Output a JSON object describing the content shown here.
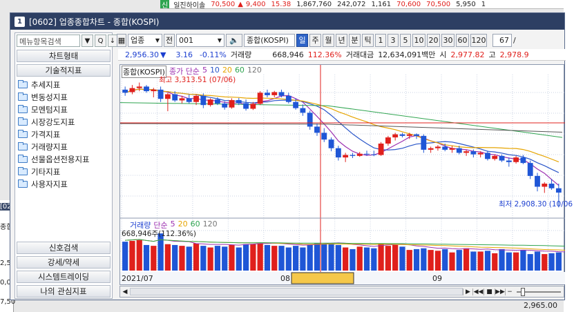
{
  "ticker": {
    "badge": "신",
    "name": "일진하이솔",
    "price": "70,500",
    "change_arrow": "▲",
    "change": "9,400",
    "rate": "15.38",
    "volume": "1,867,760",
    "v2": "242,072",
    "v3": "1,161",
    "v4": "70,600",
    "v5": "70,500",
    "v6": "5,950",
    "v7": "1"
  },
  "bg_left": {
    "labels": [
      "[02",
      "종합",
      "2,50",
      "0,00",
      "7,50"
    ]
  },
  "bg_right": {
    "value": "2,965.00"
  },
  "window": {
    "number": "1",
    "title": "[0602] 업종종합차트 - 종합(KOSPI)"
  },
  "left_panel": {
    "search_placeholder": "메뉴항목검색",
    "btn_dropdown": "▼",
    "btn_search": "Q",
    "btn_down": "↓",
    "section_chart_type": "차트형태",
    "section_tech": "기술적지표",
    "folders": [
      "추세지표",
      "변동성지표",
      "모멘텀지표",
      "시장강도지표",
      "가격지표",
      "거래량지표",
      "선물옵션전용지표",
      "기타지표",
      "사용자지표"
    ],
    "bottom_buttons": [
      "신호검색",
      "강세/약세",
      "시스템트레이딩",
      "나의 관심지표"
    ]
  },
  "toolbar": {
    "sector_type": "업종",
    "jeon": "전",
    "code": "001",
    "name": "종합(KOSPI)",
    "periods": [
      "일",
      "주",
      "월",
      "년",
      "분",
      "틱"
    ],
    "selected_period": "일",
    "minutes": [
      "1",
      "3",
      "5",
      "10",
      "20",
      "30",
      "60",
      "120"
    ],
    "page": "67",
    "page_sep": "/"
  },
  "infobar": {
    "price": "2,956.30",
    "arrow": "▼",
    "change": "3.16",
    "rate": "-0.11%",
    "vol_label": "거래량",
    "volume": "668,946",
    "vol_rate": "112.36%",
    "amt_label": "거래대금",
    "amount": "12,634,091백만",
    "open_label": "시",
    "open": "2,977.82",
    "high_label": "고",
    "high": "2,978.9"
  },
  "chart": {
    "price_legend": {
      "name": "종합(KOSPI)",
      "ma_label": "종가 단순",
      "ma": [
        "5",
        "10",
        "20",
        "60",
        "120"
      ]
    },
    "max_label": "최고 3,313.51 (07/06)",
    "min_label": "최저 2,908.30 (10/06",
    "vol_legend": {
      "name": "거래량",
      "ma_label": "단순",
      "ma": [
        "5",
        "20",
        "60",
        "120"
      ]
    },
    "vol_value": "668,946주(112.36%)",
    "x_labels": [
      "2021/07",
      "08",
      "09"
    ],
    "colors": {
      "up": "#e0201c",
      "down": "#1f56d6",
      "ma5": "#9c2fb0",
      "ma10": "#2a56c9",
      "ma20": "#e6a400",
      "ma60": "#2ea44f",
      "ma120": "#555555"
    }
  },
  "chart_data": {
    "type": "candlestick",
    "candles": [
      [
        3290,
        3300,
        3270,
        3280
      ],
      [
        3282,
        3305,
        3275,
        3295
      ],
      [
        3295,
        3313,
        3285,
        3300
      ],
      [
        3300,
        3305,
        3280,
        3285
      ],
      [
        3285,
        3296,
        3265,
        3290
      ],
      [
        3290,
        3300,
        3250,
        3260
      ],
      [
        3260,
        3280,
        3220,
        3275
      ],
      [
        3275,
        3285,
        3250,
        3255
      ],
      [
        3255,
        3270,
        3245,
        3262
      ],
      [
        3262,
        3275,
        3245,
        3250
      ],
      [
        3250,
        3275,
        3240,
        3270
      ],
      [
        3270,
        3278,
        3230,
        3240
      ],
      [
        3240,
        3262,
        3235,
        3258
      ],
      [
        3258,
        3265,
        3240,
        3245
      ],
      [
        3245,
        3252,
        3225,
        3232
      ],
      [
        3232,
        3262,
        3228,
        3256
      ],
      [
        3256,
        3263,
        3240,
        3246
      ],
      [
        3246,
        3258,
        3222,
        3228
      ],
      [
        3228,
        3250,
        3224,
        3244
      ],
      [
        3244,
        3285,
        3240,
        3280
      ],
      [
        3280,
        3290,
        3265,
        3272
      ],
      [
        3272,
        3286,
        3265,
        3282
      ],
      [
        3282,
        3290,
        3265,
        3270
      ],
      [
        3270,
        3280,
        3245,
        3250
      ],
      [
        3250,
        3262,
        3225,
        3230
      ],
      [
        3230,
        3242,
        3205,
        3215
      ],
      [
        3215,
        3222,
        3160,
        3170
      ],
      [
        3170,
        3180,
        3140,
        3150
      ],
      [
        3150,
        3165,
        3120,
        3128
      ],
      [
        3128,
        3135,
        3090,
        3100
      ],
      [
        3100,
        3108,
        3060,
        3070
      ],
      [
        3070,
        3085,
        3055,
        3078
      ],
      [
        3078,
        3085,
        3068,
        3075
      ],
      [
        3075,
        3088,
        3072,
        3082
      ],
      [
        3082,
        3092,
        3075,
        3080
      ],
      [
        3080,
        3092,
        3074,
        3078
      ],
      [
        3078,
        3120,
        3075,
        3115
      ],
      [
        3115,
        3140,
        3108,
        3135
      ],
      [
        3135,
        3150,
        3125,
        3145
      ],
      [
        3145,
        3150,
        3135,
        3140
      ],
      [
        3140,
        3150,
        3130,
        3145
      ],
      [
        3145,
        3148,
        3130,
        3140
      ],
      [
        3140,
        3145,
        3085,
        3095
      ],
      [
        3095,
        3105,
        3085,
        3100
      ],
      [
        3100,
        3110,
        3092,
        3105
      ],
      [
        3105,
        3115,
        3090,
        3095
      ],
      [
        3095,
        3108,
        3085,
        3100
      ],
      [
        3100,
        3108,
        3080,
        3085
      ],
      [
        3085,
        3095,
        3075,
        3090
      ],
      [
        3090,
        3096,
        3070,
        3080
      ],
      [
        3080,
        3090,
        3070,
        3085
      ],
      [
        3085,
        3092,
        3060,
        3065
      ],
      [
        3065,
        3080,
        3060,
        3075
      ],
      [
        3075,
        3080,
        3055,
        3060
      ],
      [
        3060,
        3070,
        3040,
        3055
      ],
      [
        3055,
        3075,
        3050,
        3070
      ],
      [
        3070,
        3078,
        3048,
        3052
      ],
      [
        3052,
        3060,
        3000,
        3010
      ],
      [
        3010,
        3020,
        2960,
        2975
      ],
      [
        2975,
        2990,
        2955,
        2985
      ],
      [
        2985,
        3000,
        2965,
        2970
      ],
      [
        2970,
        2985,
        2908,
        2956
      ]
    ],
    "volume_ratio": [
      0.7,
      0.72,
      0.74,
      0.62,
      0.6,
      0.9,
      0.64,
      0.62,
      0.6,
      0.58,
      0.66,
      0.6,
      0.56,
      0.6,
      0.58,
      0.62,
      0.56,
      0.64,
      0.64,
      0.66,
      0.62,
      0.6,
      0.6,
      0.56,
      0.6,
      0.56,
      0.62,
      0.66,
      0.64,
      0.66,
      0.62,
      0.56,
      0.52,
      0.58,
      0.56,
      0.54,
      0.66,
      0.6,
      0.62,
      0.58,
      0.5,
      0.52,
      0.54,
      0.5,
      0.48,
      0.52,
      0.44,
      0.5,
      0.54,
      0.46,
      0.46,
      0.48,
      0.42,
      0.52,
      0.44,
      0.44,
      0.5,
      0.4,
      0.46,
      0.4,
      0.42,
      0.44,
      0.38
    ],
    "ylim": [
      2900,
      3330
    ]
  }
}
